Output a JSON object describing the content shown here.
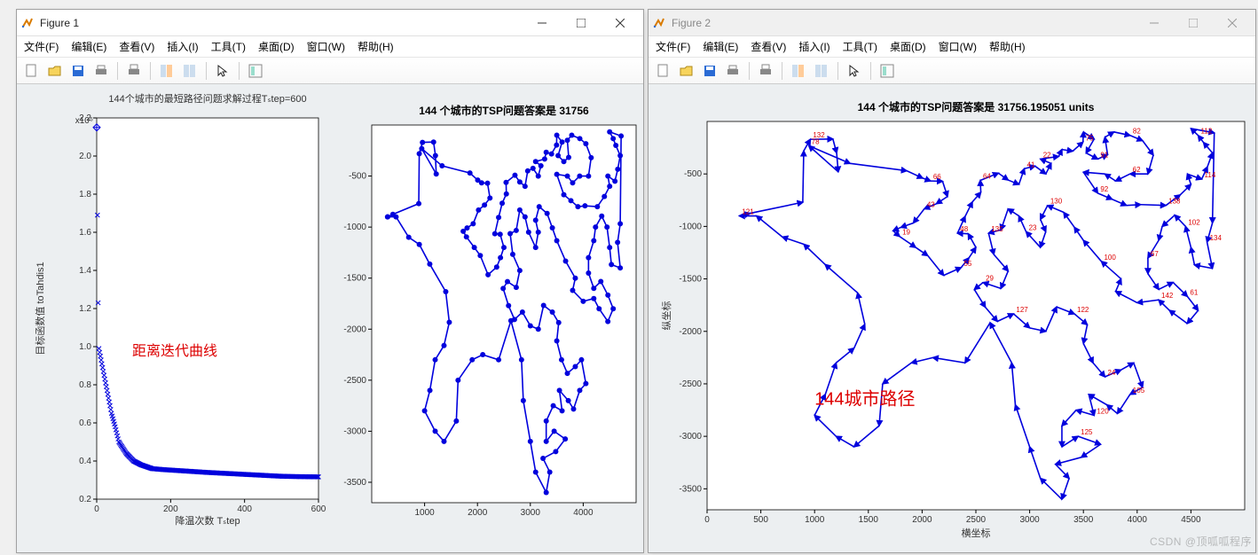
{
  "window1": {
    "title": "Figure 1",
    "annotation": "距离迭代曲线",
    "left_title": "144个城市的最短路径问题求解过程Tₛtep=600",
    "left_expo": "x10⁵",
    "left_xlabel": "降温次数 Tₛtep",
    "left_ylabel": "目标函数值 toTahdis1",
    "right_title": "144 个城市的TSP问题答案是  31756"
  },
  "window2": {
    "title": "Figure 2",
    "annotation": "144城市路径",
    "chart_title": "144 个城市的TSP问题答案是  31756.195051 units",
    "xlabel": "横坐标",
    "ylabel": "纵坐标"
  },
  "menus": {
    "file": "文件(F)",
    "edit": "编辑(E)",
    "view": "查看(V)",
    "insert": "插入(I)",
    "tools": "工具(T)",
    "desktop": "桌面(D)",
    "window": "窗口(W)",
    "help": "帮助(H)"
  },
  "toolbar_icons": [
    "new",
    "open",
    "save",
    "print",
    "sep",
    "print2",
    "sep",
    "dock1",
    "dock2",
    "sep",
    "pointer",
    "sep",
    "colorbar"
  ],
  "watermark": "CSDN @顶呱呱程序",
  "chart_data": [
    {
      "type": "line",
      "title": "144个城市的最短路径问题求解过程Tₛtep=600",
      "xlabel": "降温次数 Tₛtep",
      "ylabel": "目标函数值 toTahdis1",
      "xlim": [
        0,
        600
      ],
      "ylim": [
        0.2,
        2.2
      ],
      "y_scale_exp": 5,
      "annotation": "距离迭代曲线",
      "x": [
        0,
        5,
        10,
        15,
        20,
        25,
        30,
        35,
        40,
        50,
        60,
        70,
        80,
        90,
        100,
        120,
        150,
        180,
        220,
        260,
        300,
        350,
        400,
        450,
        500,
        550,
        600
      ],
      "values": [
        2.15,
        1.0,
        0.95,
        0.9,
        0.85,
        0.8,
        0.75,
        0.7,
        0.65,
        0.58,
        0.5,
        0.47,
        0.44,
        0.42,
        0.4,
        0.38,
        0.36,
        0.355,
        0.35,
        0.345,
        0.34,
        0.335,
        0.33,
        0.325,
        0.32,
        0.318,
        0.317
      ]
    },
    {
      "type": "line",
      "title": "144 个城市的TSP问题答案是  31756.195051 units",
      "xlabel": "横坐标",
      "ylabel": "纵坐标",
      "xlim": [
        0,
        5000
      ],
      "ylim": [
        -3700,
        0
      ],
      "annotation": "144城市路径",
      "n_cities": 144,
      "sample_city_labels": [
        121,
        132,
        78,
        66,
        43,
        19,
        55,
        48,
        64,
        41,
        22,
        75,
        91,
        82,
        62,
        92,
        138,
        114,
        112,
        134,
        102,
        67,
        61,
        142,
        100,
        130,
        23,
        135,
        29,
        127,
        122,
        24,
        105,
        120,
        125
      ],
      "path": [
        [
          300,
          -900
        ],
        [
          400,
          -875
        ],
        [
          890,
          -770
        ],
        [
          899,
          -281
        ],
        [
          960,
          -170
        ],
        [
          1170,
          -167
        ],
        [
          1205,
          -300
        ],
        [
          1220,
          -480
        ],
        [
          946,
          -231
        ],
        [
          1330,
          -400
        ],
        [
          1857,
          -470
        ],
        [
          2005,
          -540
        ],
        [
          2078,
          -567
        ],
        [
          2190,
          -570
        ],
        [
          2236,
          -715
        ],
        [
          2133,
          -784
        ],
        [
          2020,
          -833
        ],
        [
          1919,
          -967
        ],
        [
          1803,
          -1009
        ],
        [
          1730,
          -1041
        ],
        [
          1791,
          -1096
        ],
        [
          1940,
          -1200
        ],
        [
          2053,
          -1279
        ],
        [
          2200,
          -1467
        ],
        [
          2363,
          -1392
        ],
        [
          2435,
          -1300
        ],
        [
          2500,
          -1200
        ],
        [
          2429,
          -1070
        ],
        [
          2329,
          -1065
        ],
        [
          2400,
          -905
        ],
        [
          2467,
          -767
        ],
        [
          2546,
          -675
        ],
        [
          2541,
          -562
        ],
        [
          2709,
          -492
        ],
        [
          2800,
          -558
        ],
        [
          2900,
          -600
        ],
        [
          2950,
          -450
        ],
        [
          3050,
          -425
        ],
        [
          3150,
          -500
        ],
        [
          3200,
          -400
        ],
        [
          3100,
          -358
        ],
        [
          3270,
          -333
        ],
        [
          3300,
          -267
        ],
        [
          3400,
          -283
        ],
        [
          3496,
          -197
        ],
        [
          3500,
          -100
        ],
        [
          3600,
          -167
        ],
        [
          3525,
          -300
        ],
        [
          3633,
          -358
        ],
        [
          3725,
          -317
        ],
        [
          3700,
          -150
        ],
        [
          3783,
          -100
        ],
        [
          3935,
          -133
        ],
        [
          4050,
          -183
        ],
        [
          4150,
          -320
        ],
        [
          4100,
          -500
        ],
        [
          3933,
          -500
        ],
        [
          3800,
          -567
        ],
        [
          3700,
          -500
        ],
        [
          3500,
          -483
        ],
        [
          3633,
          -683
        ],
        [
          3767,
          -741
        ],
        [
          3900,
          -800
        ],
        [
          4033,
          -792
        ],
        [
          4267,
          -800
        ],
        [
          4400,
          -700
        ],
        [
          4500,
          -600
        ],
        [
          4467,
          -500
        ],
        [
          4600,
          -550
        ],
        [
          4653,
          -433
        ],
        [
          4700,
          -300
        ],
        [
          4617,
          -200
        ],
        [
          4567,
          -133
        ],
        [
          4500,
          -67
        ],
        [
          4717,
          -108
        ],
        [
          4700,
          -967
        ],
        [
          4650,
          -1150
        ],
        [
          4700,
          -1400
        ],
        [
          4533,
          -1367
        ],
        [
          4500,
          -1200
        ],
        [
          4450,
          -1000
        ],
        [
          4350,
          -892
        ],
        [
          4233,
          -1000
        ],
        [
          4200,
          -1133
        ],
        [
          4100,
          -1300
        ],
        [
          4100,
          -1450
        ],
        [
          4200,
          -1600
        ],
        [
          4333,
          -1533
        ],
        [
          4467,
          -1667
        ],
        [
          4567,
          -1800
        ],
        [
          4466,
          -1925
        ],
        [
          4300,
          -1800
        ],
        [
          4200,
          -1700
        ],
        [
          4000,
          -1727
        ],
        [
          3800,
          -1620
        ],
        [
          3850,
          -1500
        ],
        [
          3667,
          -1333
        ],
        [
          3500,
          -1133
        ],
        [
          3416,
          -1008
        ],
        [
          3317,
          -866
        ],
        [
          3167,
          -800
        ],
        [
          3100,
          -933
        ],
        [
          3150,
          -1050
        ],
        [
          3100,
          -1200
        ],
        [
          2967,
          -1050
        ],
        [
          2900,
          -900
        ],
        [
          2800,
          -833
        ],
        [
          2733,
          -1033
        ],
        [
          2618,
          -1064
        ],
        [
          2667,
          -1267
        ],
        [
          2800,
          -1425
        ],
        [
          2733,
          -1591
        ],
        [
          2567,
          -1534
        ],
        [
          2486,
          -1601
        ],
        [
          2588,
          -1770
        ],
        [
          2700,
          -1905
        ],
        [
          2850,
          -1833
        ],
        [
          3000,
          -1967
        ],
        [
          3150,
          -2000
        ],
        [
          3250,
          -1767
        ],
        [
          3416,
          -1833
        ],
        [
          3536,
          -1936
        ],
        [
          3500,
          -2115
        ],
        [
          3590,
          -2300
        ],
        [
          3700,
          -2433
        ],
        [
          3850,
          -2367
        ],
        [
          3967,
          -2300
        ],
        [
          4050,
          -2533
        ],
        [
          3934,
          -2600
        ],
        [
          3817,
          -2783
        ],
        [
          3718,
          -2700
        ],
        [
          3550,
          -2600
        ],
        [
          3600,
          -2800
        ],
        [
          3433,
          -2750
        ],
        [
          3300,
          -2900
        ],
        [
          3300,
          -3100
        ],
        [
          3450,
          -3000
        ],
        [
          3660,
          -3076
        ],
        [
          3480,
          -3200
        ],
        [
          3240,
          -3266
        ],
        [
          3367,
          -3400
        ],
        [
          3300,
          -3600
        ],
        [
          3100,
          -3400
        ],
        [
          3000,
          -3100
        ],
        [
          2867,
          -2700
        ],
        [
          2833,
          -2300
        ],
        [
          2633,
          -1917
        ],
        [
          2400,
          -2300
        ],
        [
          2100,
          -2250
        ],
        [
          1900,
          -2300
        ],
        [
          1633,
          -2500
        ],
        [
          1600,
          -2900
        ],
        [
          1367,
          -3100
        ],
        [
          1200,
          -3000
        ],
        [
          1000,
          -2800
        ],
        [
          1100,
          -2600
        ],
        [
          1200,
          -2300
        ],
        [
          1367,
          -2160
        ],
        [
          1467,
          -1933
        ],
        [
          1400,
          -1633
        ],
        [
          1098,
          -1363
        ],
        [
          900,
          -1170
        ],
        [
          700,
          -1100
        ],
        [
          460,
          -900
        ],
        [
          300,
          -900
        ]
      ]
    }
  ]
}
